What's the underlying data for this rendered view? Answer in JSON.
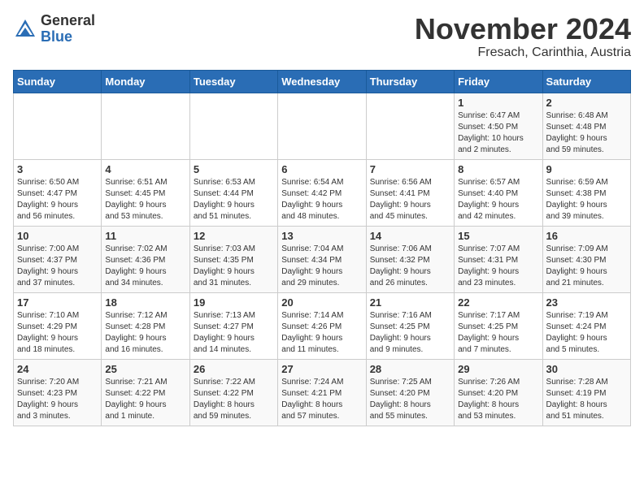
{
  "logo": {
    "general": "General",
    "blue": "Blue"
  },
  "title": "November 2024",
  "location": "Fresach, Carinthia, Austria",
  "days_of_week": [
    "Sunday",
    "Monday",
    "Tuesday",
    "Wednesday",
    "Thursday",
    "Friday",
    "Saturday"
  ],
  "weeks": [
    [
      {
        "day": "",
        "info": ""
      },
      {
        "day": "",
        "info": ""
      },
      {
        "day": "",
        "info": ""
      },
      {
        "day": "",
        "info": ""
      },
      {
        "day": "",
        "info": ""
      },
      {
        "day": "1",
        "info": "Sunrise: 6:47 AM\nSunset: 4:50 PM\nDaylight: 10 hours\nand 2 minutes."
      },
      {
        "day": "2",
        "info": "Sunrise: 6:48 AM\nSunset: 4:48 PM\nDaylight: 9 hours\nand 59 minutes."
      }
    ],
    [
      {
        "day": "3",
        "info": "Sunrise: 6:50 AM\nSunset: 4:47 PM\nDaylight: 9 hours\nand 56 minutes."
      },
      {
        "day": "4",
        "info": "Sunrise: 6:51 AM\nSunset: 4:45 PM\nDaylight: 9 hours\nand 53 minutes."
      },
      {
        "day": "5",
        "info": "Sunrise: 6:53 AM\nSunset: 4:44 PM\nDaylight: 9 hours\nand 51 minutes."
      },
      {
        "day": "6",
        "info": "Sunrise: 6:54 AM\nSunset: 4:42 PM\nDaylight: 9 hours\nand 48 minutes."
      },
      {
        "day": "7",
        "info": "Sunrise: 6:56 AM\nSunset: 4:41 PM\nDaylight: 9 hours\nand 45 minutes."
      },
      {
        "day": "8",
        "info": "Sunrise: 6:57 AM\nSunset: 4:40 PM\nDaylight: 9 hours\nand 42 minutes."
      },
      {
        "day": "9",
        "info": "Sunrise: 6:59 AM\nSunset: 4:38 PM\nDaylight: 9 hours\nand 39 minutes."
      }
    ],
    [
      {
        "day": "10",
        "info": "Sunrise: 7:00 AM\nSunset: 4:37 PM\nDaylight: 9 hours\nand 37 minutes."
      },
      {
        "day": "11",
        "info": "Sunrise: 7:02 AM\nSunset: 4:36 PM\nDaylight: 9 hours\nand 34 minutes."
      },
      {
        "day": "12",
        "info": "Sunrise: 7:03 AM\nSunset: 4:35 PM\nDaylight: 9 hours\nand 31 minutes."
      },
      {
        "day": "13",
        "info": "Sunrise: 7:04 AM\nSunset: 4:34 PM\nDaylight: 9 hours\nand 29 minutes."
      },
      {
        "day": "14",
        "info": "Sunrise: 7:06 AM\nSunset: 4:32 PM\nDaylight: 9 hours\nand 26 minutes."
      },
      {
        "day": "15",
        "info": "Sunrise: 7:07 AM\nSunset: 4:31 PM\nDaylight: 9 hours\nand 23 minutes."
      },
      {
        "day": "16",
        "info": "Sunrise: 7:09 AM\nSunset: 4:30 PM\nDaylight: 9 hours\nand 21 minutes."
      }
    ],
    [
      {
        "day": "17",
        "info": "Sunrise: 7:10 AM\nSunset: 4:29 PM\nDaylight: 9 hours\nand 18 minutes."
      },
      {
        "day": "18",
        "info": "Sunrise: 7:12 AM\nSunset: 4:28 PM\nDaylight: 9 hours\nand 16 minutes."
      },
      {
        "day": "19",
        "info": "Sunrise: 7:13 AM\nSunset: 4:27 PM\nDaylight: 9 hours\nand 14 minutes."
      },
      {
        "day": "20",
        "info": "Sunrise: 7:14 AM\nSunset: 4:26 PM\nDaylight: 9 hours\nand 11 minutes."
      },
      {
        "day": "21",
        "info": "Sunrise: 7:16 AM\nSunset: 4:25 PM\nDaylight: 9 hours\nand 9 minutes."
      },
      {
        "day": "22",
        "info": "Sunrise: 7:17 AM\nSunset: 4:25 PM\nDaylight: 9 hours\nand 7 minutes."
      },
      {
        "day": "23",
        "info": "Sunrise: 7:19 AM\nSunset: 4:24 PM\nDaylight: 9 hours\nand 5 minutes."
      }
    ],
    [
      {
        "day": "24",
        "info": "Sunrise: 7:20 AM\nSunset: 4:23 PM\nDaylight: 9 hours\nand 3 minutes."
      },
      {
        "day": "25",
        "info": "Sunrise: 7:21 AM\nSunset: 4:22 PM\nDaylight: 9 hours\nand 1 minute."
      },
      {
        "day": "26",
        "info": "Sunrise: 7:22 AM\nSunset: 4:22 PM\nDaylight: 8 hours\nand 59 minutes."
      },
      {
        "day": "27",
        "info": "Sunrise: 7:24 AM\nSunset: 4:21 PM\nDaylight: 8 hours\nand 57 minutes."
      },
      {
        "day": "28",
        "info": "Sunrise: 7:25 AM\nSunset: 4:20 PM\nDaylight: 8 hours\nand 55 minutes."
      },
      {
        "day": "29",
        "info": "Sunrise: 7:26 AM\nSunset: 4:20 PM\nDaylight: 8 hours\nand 53 minutes."
      },
      {
        "day": "30",
        "info": "Sunrise: 7:28 AM\nSunset: 4:19 PM\nDaylight: 8 hours\nand 51 minutes."
      }
    ]
  ]
}
